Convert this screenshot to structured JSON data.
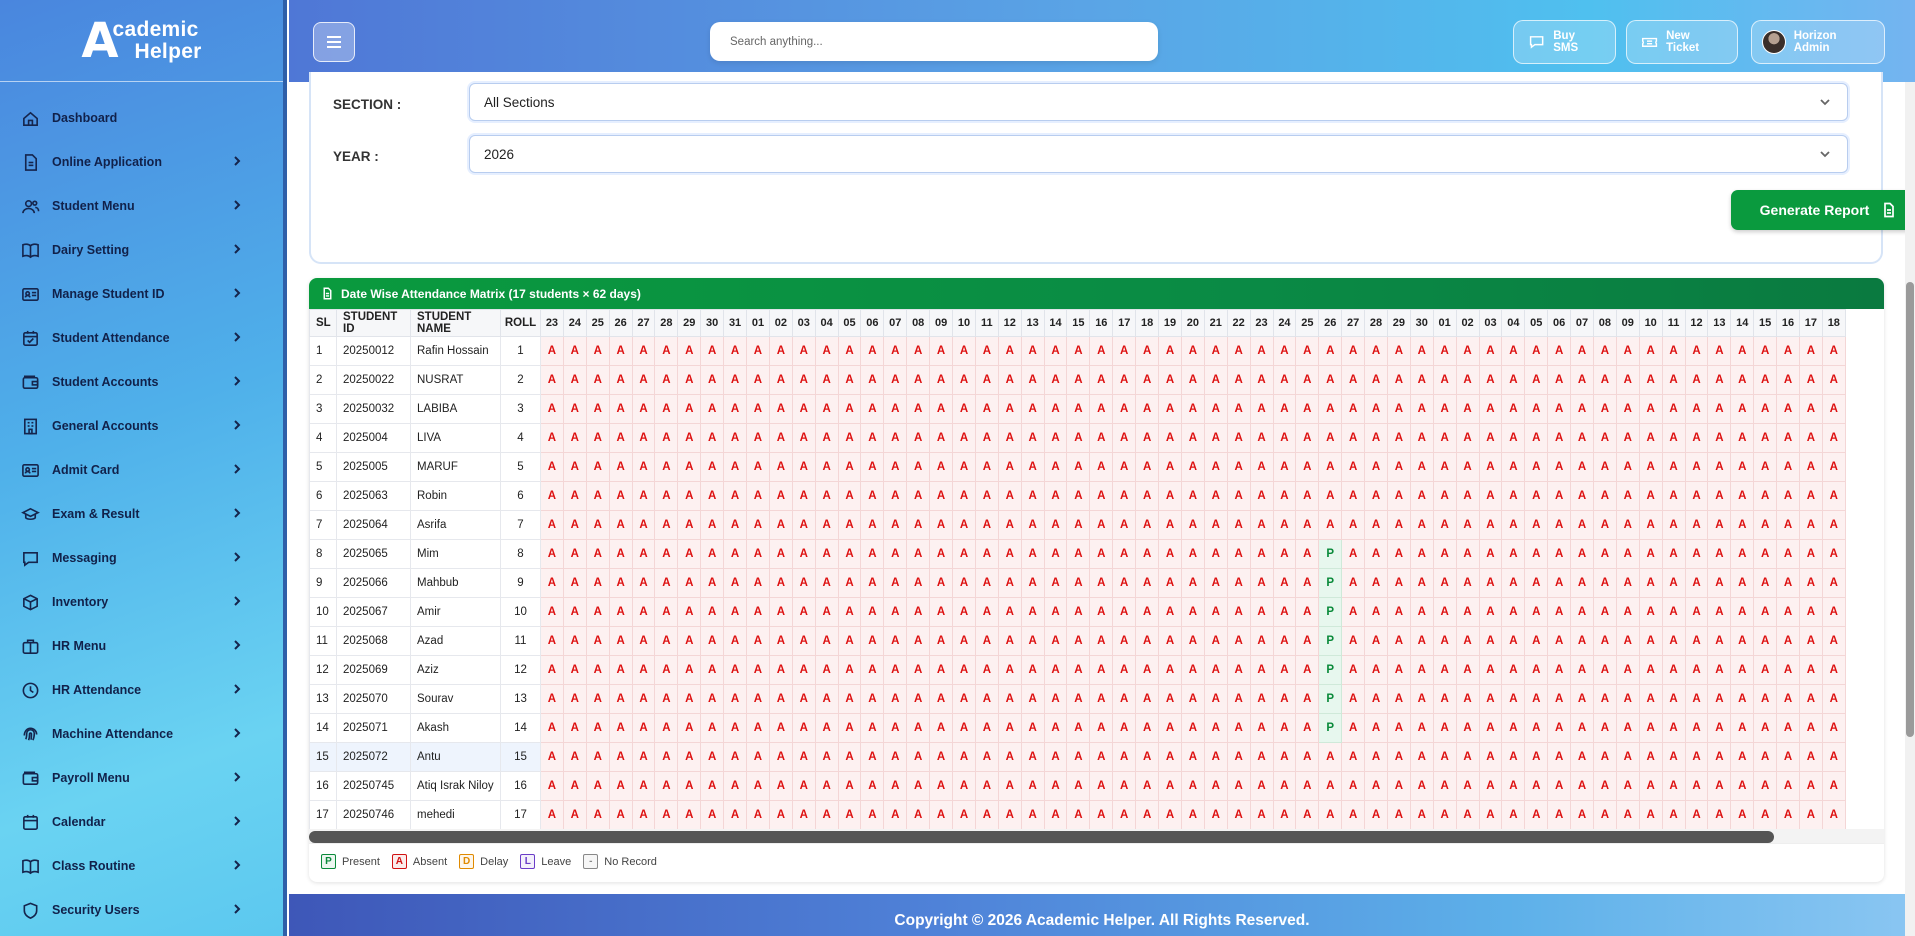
{
  "app": {
    "logo_mark": "A",
    "logo_line1": "cademic",
    "logo_line2": "Helper"
  },
  "sidebar": {
    "items": [
      {
        "label": "Dashboard",
        "icon": "home-icon",
        "has_chevron": false
      },
      {
        "label": "Online Application",
        "icon": "document-icon",
        "has_chevron": true
      },
      {
        "label": "Student Menu",
        "icon": "users-icon",
        "has_chevron": true
      },
      {
        "label": "Dairy Setting",
        "icon": "book-icon",
        "has_chevron": true
      },
      {
        "label": "Manage Student ID",
        "icon": "id-card-icon",
        "has_chevron": true
      },
      {
        "label": "Student Attendance",
        "icon": "calendar-check-icon",
        "has_chevron": true
      },
      {
        "label": "Student Accounts",
        "icon": "wallet-icon",
        "has_chevron": true
      },
      {
        "label": "General Accounts",
        "icon": "building-icon",
        "has_chevron": true
      },
      {
        "label": "Admit Card",
        "icon": "id-card-icon",
        "has_chevron": true
      },
      {
        "label": "Exam & Result",
        "icon": "graduation-cap-icon",
        "has_chevron": true
      },
      {
        "label": "Messaging",
        "icon": "message-icon",
        "has_chevron": true
      },
      {
        "label": "Inventory",
        "icon": "box-icon",
        "has_chevron": true
      },
      {
        "label": "HR Menu",
        "icon": "briefcase-icon",
        "has_chevron": true
      },
      {
        "label": "HR Attendance",
        "icon": "clock-icon",
        "has_chevron": true
      },
      {
        "label": "Machine Attendance",
        "icon": "fingerprint-icon",
        "has_chevron": true
      },
      {
        "label": "Payroll Menu",
        "icon": "wallet-icon",
        "has_chevron": true
      },
      {
        "label": "Calendar",
        "icon": "calendar-icon",
        "has_chevron": true
      },
      {
        "label": "Class Routine",
        "icon": "book-icon",
        "has_chevron": true
      },
      {
        "label": "Security Users",
        "icon": "shield-icon",
        "has_chevron": true
      }
    ]
  },
  "header": {
    "search_placeholder": "Search anything...",
    "buy_sms": "Buy SMS",
    "new_ticket": "New Ticket",
    "user": "Horizon Admin"
  },
  "form": {
    "section_label": "SECTION :",
    "section_value": "All Sections",
    "year_label": "YEAR :",
    "year_value": "2026",
    "generate_label": "Generate Report"
  },
  "matrix": {
    "title": "Date Wise Attendance Matrix (17 students × 62 days)",
    "columns": [
      "SL",
      "STUDENT ID",
      "STUDENT NAME",
      "ROLL"
    ],
    "days": [
      "23",
      "24",
      "25",
      "26",
      "27",
      "28",
      "29",
      "30",
      "31",
      "01",
      "02",
      "03",
      "04",
      "05",
      "06",
      "07",
      "08",
      "09",
      "10",
      "11",
      "12",
      "13",
      "14",
      "15",
      "16",
      "17",
      "18",
      "19",
      "20",
      "21",
      "22",
      "23",
      "24",
      "25",
      "26",
      "27",
      "28",
      "29",
      "30",
      "01",
      "02",
      "03",
      "04",
      "05",
      "06",
      "07",
      "08",
      "09",
      "10",
      "11",
      "12",
      "13",
      "14",
      "15",
      "16",
      "17",
      "18"
    ],
    "present_day_index": 34,
    "students": [
      {
        "sl": "1",
        "id": "20250012",
        "name": "Rafin Hossain",
        "roll": "1",
        "present": false
      },
      {
        "sl": "2",
        "id": "20250022",
        "name": "NUSRAT",
        "roll": "2",
        "present": false
      },
      {
        "sl": "3",
        "id": "20250032",
        "name": "LABIBA",
        "roll": "3",
        "present": false
      },
      {
        "sl": "4",
        "id": "2025004",
        "name": "LIVA",
        "roll": "4",
        "present": false
      },
      {
        "sl": "5",
        "id": "2025005",
        "name": "MARUF",
        "roll": "5",
        "present": false
      },
      {
        "sl": "6",
        "id": "2025063",
        "name": "Robin",
        "roll": "6",
        "present": false
      },
      {
        "sl": "7",
        "id": "2025064",
        "name": "Asrifa",
        "roll": "7",
        "present": false
      },
      {
        "sl": "8",
        "id": "2025065",
        "name": "Mim",
        "roll": "8",
        "present": true
      },
      {
        "sl": "9",
        "id": "2025066",
        "name": "Mahbub",
        "roll": "9",
        "present": true
      },
      {
        "sl": "10",
        "id": "2025067",
        "name": "Amir",
        "roll": "10",
        "present": true
      },
      {
        "sl": "11",
        "id": "2025068",
        "name": "Azad",
        "roll": "11",
        "present": true
      },
      {
        "sl": "12",
        "id": "2025069",
        "name": "Aziz",
        "roll": "12",
        "present": true
      },
      {
        "sl": "13",
        "id": "2025070",
        "name": "Sourav",
        "roll": "13",
        "present": true
      },
      {
        "sl": "14",
        "id": "2025071",
        "name": "Akash",
        "roll": "14",
        "present": true
      },
      {
        "sl": "15",
        "id": "2025072",
        "name": "Antu",
        "roll": "15",
        "present": false
      },
      {
        "sl": "16",
        "id": "20250745",
        "name": "Atiq Israk Niloy",
        "roll": "16",
        "present": false
      },
      {
        "sl": "17",
        "id": "20250746",
        "name": "mehedi",
        "roll": "17",
        "present": false
      }
    ],
    "absent_mark": "A",
    "present_mark": "P"
  },
  "legend": [
    {
      "code": "P",
      "label": "Present",
      "color": "#0a8a3a"
    },
    {
      "code": "A",
      "label": "Absent",
      "color": "#d11111"
    },
    {
      "code": "D",
      "label": "Delay",
      "color": "#e08a00"
    },
    {
      "code": "L",
      "label": "Leave",
      "color": "#6a3cc8"
    },
    {
      "code": "-",
      "label": "No Record",
      "color": "#888888"
    }
  ],
  "footer": {
    "text": "Copyright © 2026 Academic Helper. All Rights Reserved."
  }
}
